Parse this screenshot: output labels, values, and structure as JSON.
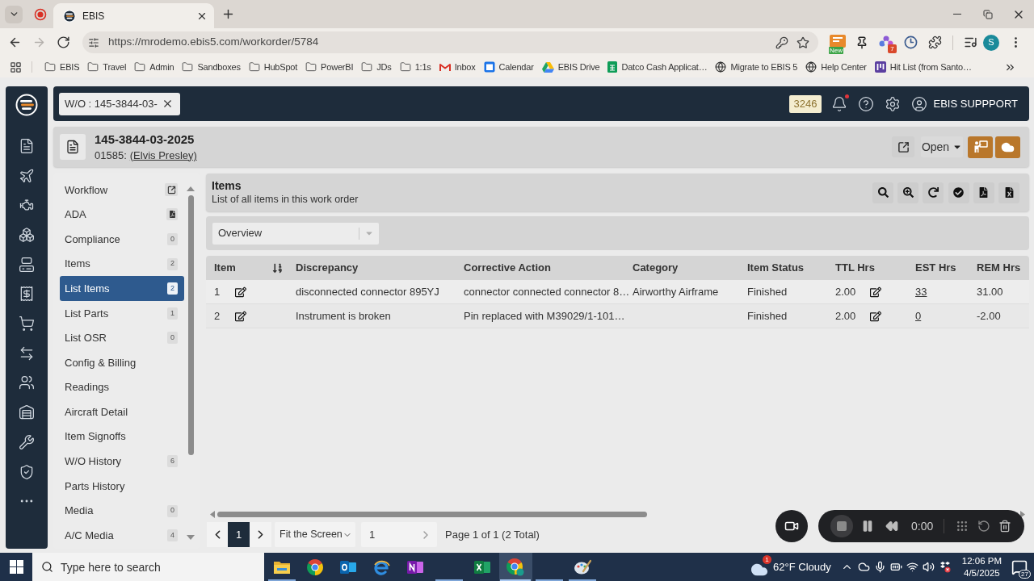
{
  "browser": {
    "tabs": [
      {
        "title": "EBIS",
        "selected": true
      }
    ],
    "nav_buttons": [
      {
        "kind": "back",
        "disabled": false
      },
      {
        "kind": "forward",
        "disabled": true
      },
      {
        "kind": "reload",
        "disabled": false
      }
    ],
    "url": "https://mrodemo.ebis5.com/workorder/5784",
    "extension_badges": [
      "New",
      "7"
    ],
    "profile": "S"
  },
  "bookmarks": [
    {
      "label": "EBIS",
      "kind": "folder"
    },
    {
      "label": "Travel",
      "kind": "folder"
    },
    {
      "label": "Admin",
      "kind": "folder"
    },
    {
      "label": "Sandboxes",
      "kind": "folder"
    },
    {
      "label": "HubSpot",
      "kind": "folder"
    },
    {
      "label": "PowerBI",
      "kind": "folder"
    },
    {
      "label": "JDs",
      "kind": "folder"
    },
    {
      "label": "1:1s",
      "kind": "folder"
    },
    {
      "label": "Inbox",
      "kind": "mail"
    },
    {
      "label": "Calendar",
      "kind": "calendar"
    },
    {
      "label": "EBIS Drive",
      "kind": "drive"
    },
    {
      "label": "Datco Cash Applicat…",
      "kind": "sheet"
    },
    {
      "label": "Migrate to EBIS 5",
      "kind": "site"
    },
    {
      "label": "Help Center",
      "kind": "site"
    },
    {
      "label": "Hit List (from Santo…",
      "kind": "board"
    }
  ],
  "app": {
    "header": {
      "open_tab": "W/O : 145-3844-03-",
      "counter": "3246",
      "notifications": true,
      "user": "EBIS SUPPPORT"
    },
    "work_order": {
      "number": "145-3844-03-2025",
      "customer_code": "01585:",
      "customer": "(Elvis Presley)",
      "status": "Open"
    },
    "nav": {
      "items": [
        {
          "label": "Workflow",
          "kind": "external",
          "selected": false
        },
        {
          "label": "ADA",
          "kind": "document",
          "selected": false
        },
        {
          "label": "Compliance",
          "kind": "count",
          "count": "0",
          "selected": false
        },
        {
          "label": "Items",
          "kind": "count",
          "count": "2",
          "selected": false
        },
        {
          "label": "List Items",
          "kind": "count",
          "count": "2",
          "selected": true
        },
        {
          "label": "List Parts",
          "kind": "count",
          "count": "1",
          "selected": false
        },
        {
          "label": "List OSR",
          "kind": "count",
          "count": "0",
          "selected": false
        },
        {
          "label": "Config & Billing",
          "kind": "plain",
          "selected": false
        },
        {
          "label": "Readings",
          "kind": "plain",
          "selected": false
        },
        {
          "label": "Aircraft Detail",
          "kind": "plain",
          "selected": false
        },
        {
          "label": "Item Signoffs",
          "kind": "plain",
          "selected": false
        },
        {
          "label": "W/O History",
          "kind": "count",
          "count": "6",
          "selected": false
        },
        {
          "label": "Parts History",
          "kind": "plain",
          "selected": false
        },
        {
          "label": "Media",
          "kind": "count",
          "count": "0",
          "selected": false
        },
        {
          "label": "A/C Media",
          "kind": "count",
          "count": "4",
          "selected": false
        }
      ]
    },
    "items_panel": {
      "title": "Items",
      "subtitle": "List of all items in this work order",
      "view": "Overview"
    },
    "table": {
      "columns": [
        "Item",
        "Discrepancy",
        "Corrective Action",
        "Category",
        "Item Status",
        "TTL Hrs",
        "EST Hrs",
        "REM Hrs"
      ],
      "rows": [
        {
          "item": "1",
          "discrepancy": "disconnected connector 895YJ",
          "corrective_action": "connector connected connector 8…",
          "category": "Airworthy Airframe",
          "status": "Finished",
          "ttl_hrs": "2.00",
          "est_hrs": "33",
          "rem_hrs": "31.00"
        },
        {
          "item": "2",
          "discrepancy": "Instrument is broken",
          "corrective_action": "Pin replaced with M39029/1-101…",
          "status": "Finished",
          "ttl_hrs": "2.00",
          "est_hrs": "0",
          "rem_hrs": "-2.00"
        }
      ]
    },
    "pager": {
      "pages": [
        {
          "label": "1",
          "selected": true
        }
      ],
      "fit": "Fit the Screen",
      "page_input": "1",
      "summary": "Page 1 of 1 (2 Total)"
    },
    "recorder": {
      "time": "0:00"
    }
  },
  "taskbar": {
    "search_placeholder": "Type here to search",
    "apps": [
      {
        "kind": "explorer",
        "running": true,
        "selected": false
      },
      {
        "kind": "chrome",
        "running": false,
        "selected": false
      },
      {
        "kind": "outlook",
        "running": false,
        "selected": false
      },
      {
        "kind": "edge",
        "running": false,
        "selected": false
      },
      {
        "kind": "onenote",
        "running": false,
        "selected": false
      },
      {
        "kind": "hidden",
        "running": true,
        "selected": false
      },
      {
        "kind": "excel",
        "running": false,
        "selected": false
      },
      {
        "kind": "chrome_profile",
        "running": true,
        "selected": true
      },
      {
        "kind": "hidden",
        "running": true,
        "selected": false
      },
      {
        "kind": "paint",
        "running": true,
        "selected": false
      }
    ],
    "weather_badge": "1",
    "weather": "62°F Cloudy",
    "time": "12:06 PM",
    "date": "4/5/2025",
    "notification_count": "27"
  }
}
